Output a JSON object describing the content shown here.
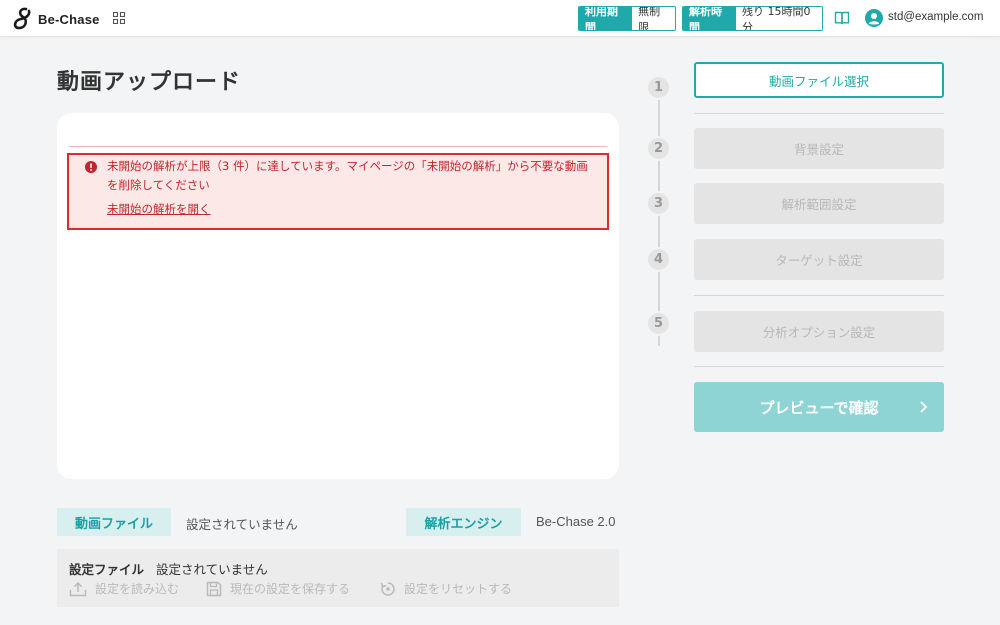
{
  "header": {
    "app_name": "Be-Chase",
    "period": {
      "key": "利用期間",
      "value": "無制限"
    },
    "analysis_time": {
      "key": "解析時間",
      "value": "残り 15時間0分"
    },
    "user_email": "std@example.com"
  },
  "page": {
    "title": "動画アップロード"
  },
  "alert": {
    "message": "未開始の解析が上限（3 件）に達しています。マイページの「未開始の解析」から不要な動画を削除してください",
    "link": "未開始の解析を開く"
  },
  "info": {
    "video_label": "動画ファイル",
    "video_value": "設定されていません",
    "engine_label": "解析エンジン",
    "engine_value": "Be-Chase 2.0"
  },
  "settings": {
    "label": "設定ファイル",
    "value": "設定されていません",
    "load": "設定を読み込む",
    "save": "現在の設定を保存する",
    "reset": "設定をリセットする"
  },
  "steps": [
    {
      "num": "1",
      "label": "動画ファイル選択"
    },
    {
      "num": "2",
      "label": "背景設定"
    },
    {
      "num": "3",
      "label": "解析範囲設定"
    },
    {
      "num": "4",
      "label": "ターゲット設定"
    },
    {
      "num": "5",
      "label": "分析オプション設定"
    }
  ],
  "preview_button": "プレビューで確認",
  "colors": {
    "accent": "#1fa9aa",
    "alert_border": "#d92e2e",
    "alert_bg": "#fde8e8",
    "alert_text": "#c0262c",
    "preview_disabled": "#8fd4d5"
  }
}
